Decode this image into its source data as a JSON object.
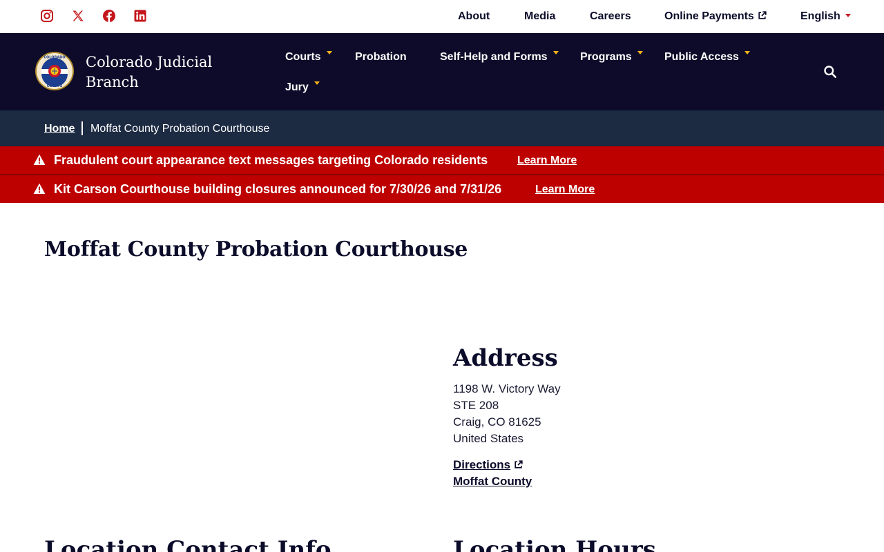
{
  "social": [
    {
      "name": "instagram-icon"
    },
    {
      "name": "x-icon"
    },
    {
      "name": "facebook-icon"
    },
    {
      "name": "linkedin-icon"
    }
  ],
  "utility_nav": {
    "about": "About",
    "media": "Media",
    "careers": "Careers",
    "online_payments": "Online Payments",
    "language": "English"
  },
  "brand": {
    "name": "Colorado Judicial Branch",
    "logo_text_top": "COLORADO",
    "logo_text_bottom": "COURTS"
  },
  "main_nav": {
    "courts": "Courts",
    "probation": "Probation",
    "self_help": "Self-Help and Forms",
    "programs": "Programs",
    "public_access": "Public Access",
    "jury": "Jury"
  },
  "breadcrumb": {
    "home": "Home",
    "current": "Moffat County Probation Courthouse"
  },
  "alerts": [
    {
      "text": "Fraudulent court appearance text messages targeting Colorado residents",
      "link": "Learn More"
    },
    {
      "text": "Kit Carson Courthouse building closures announced for 7/30/26 and 7/31/26",
      "link": "Learn More"
    }
  ],
  "page": {
    "title": "Moffat County Probation Courthouse"
  },
  "address": {
    "heading": "Address",
    "lines": [
      "1198 W. Victory Way",
      "STE 208",
      "Craig, CO 81625",
      "United States"
    ],
    "directions": "Directions",
    "county_link": "Moffat County"
  },
  "sections": {
    "contact": "Location Contact Info",
    "hours": "Location Hours"
  },
  "colors": {
    "header_bg": "#0d0b29",
    "breadcrumb_bg": "#1c2a42",
    "alert_bg": "#bd0000",
    "social_red": "#c4161c",
    "nav_caret_gold": "#f5b11a"
  }
}
